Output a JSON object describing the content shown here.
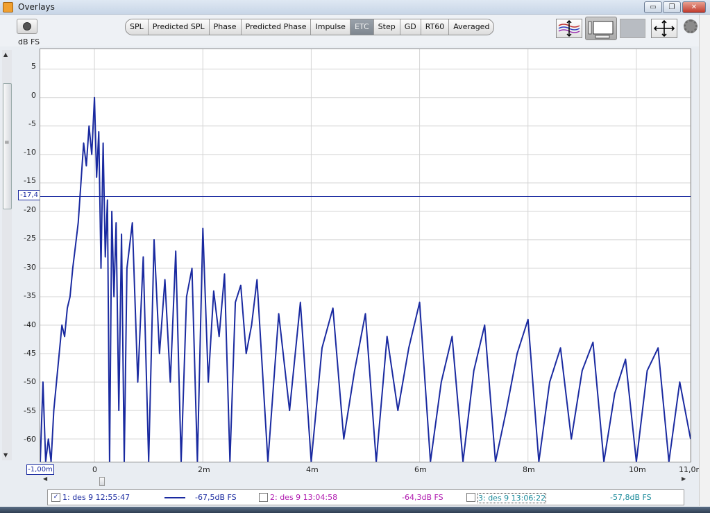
{
  "window": {
    "title": "Overlays",
    "minimize": "▭",
    "maximize": "❐",
    "close": "✕"
  },
  "toolbar": {
    "unit_label": "dB FS",
    "tabs": [
      {
        "label": "SPL",
        "active": false
      },
      {
        "label": "Predicted SPL",
        "active": false
      },
      {
        "label": "Phase",
        "active": false
      },
      {
        "label": "Predicted Phase",
        "active": false
      },
      {
        "label": "Impulse",
        "active": false
      },
      {
        "label": "ETC",
        "active": true
      },
      {
        "label": "Step",
        "active": false
      },
      {
        "label": "GD",
        "active": false
      },
      {
        "label": "RT60",
        "active": false
      },
      {
        "label": "Averaged",
        "active": false
      }
    ],
    "tools": [
      "y-scale-icon",
      "graph-view-icon",
      "blank-tool-icon",
      "expand-icon",
      "gear-icon"
    ]
  },
  "plot": {
    "cursor_label": "-17,4",
    "x_start_label": "-1,00m"
  },
  "chart_data": {
    "type": "line",
    "title": "",
    "ylabel": "dB FS",
    "xlabel": "",
    "ylim": [
      -64,
      8.5
    ],
    "xlim": [
      -1.0,
      11.0
    ],
    "y_ticks": [
      "5",
      "0",
      "-5",
      "-10",
      "-15",
      "-20",
      "-25",
      "-30",
      "-35",
      "-40",
      "-45",
      "-50",
      "-55",
      "-60"
    ],
    "x_ticks": [
      "0",
      "2m",
      "4m",
      "6m",
      "8m",
      "10m",
      "11,0ms"
    ],
    "x_tick_values": [
      0,
      2,
      4,
      6,
      8,
      10,
      11
    ],
    "cursor_y": -17.4,
    "grid": true,
    "series": [
      {
        "name": "1: des 9 12:55:47",
        "color": "#1a2aa0",
        "x": [
          -1.0,
          -0.95,
          -0.9,
          -0.85,
          -0.8,
          -0.75,
          -0.7,
          -0.65,
          -0.6,
          -0.55,
          -0.5,
          -0.45,
          -0.4,
          -0.35,
          -0.3,
          -0.25,
          -0.2,
          -0.15,
          -0.1,
          -0.05,
          0.0,
          0.04,
          0.08,
          0.12,
          0.16,
          0.2,
          0.24,
          0.28,
          0.32,
          0.36,
          0.4,
          0.45,
          0.5,
          0.55,
          0.6,
          0.7,
          0.8,
          0.9,
          1.0,
          1.1,
          1.2,
          1.3,
          1.4,
          1.5,
          1.6,
          1.7,
          1.8,
          1.9,
          2.0,
          2.1,
          2.2,
          2.3,
          2.4,
          2.5,
          2.6,
          2.7,
          2.8,
          2.9,
          3.0,
          3.2,
          3.4,
          3.6,
          3.8,
          4.0,
          4.2,
          4.4,
          4.6,
          4.8,
          5.0,
          5.2,
          5.4,
          5.6,
          5.8,
          6.0,
          6.2,
          6.4,
          6.6,
          6.8,
          7.0,
          7.2,
          7.4,
          7.6,
          7.8,
          8.0,
          8.2,
          8.4,
          8.6,
          8.8,
          9.0,
          9.2,
          9.4,
          9.6,
          9.8,
          10.0,
          10.2,
          10.4,
          10.6,
          10.8,
          11.0
        ],
        "y": [
          -64,
          -50,
          -64,
          -60,
          -64,
          -55,
          -50,
          -45,
          -40,
          -42,
          -37,
          -35,
          -30,
          -26,
          -22,
          -15,
          -8,
          -12,
          -5,
          -10,
          0,
          -14,
          -6,
          -30,
          -8,
          -28,
          -18,
          -64,
          -20,
          -35,
          -22,
          -55,
          -24,
          -64,
          -30,
          -22,
          -50,
          -28,
          -64,
          -25,
          -45,
          -32,
          -50,
          -27,
          -64,
          -35,
          -30,
          -64,
          -23,
          -50,
          -34,
          -42,
          -31,
          -64,
          -36,
          -33,
          -45,
          -40,
          -32,
          -64,
          -38,
          -55,
          -36,
          -64,
          -44,
          -37,
          -60,
          -48,
          -38,
          -64,
          -42,
          -55,
          -44,
          -36,
          -64,
          -50,
          -42,
          -64,
          -48,
          -40,
          -64,
          -55,
          -45,
          -39,
          -64,
          -50,
          -44,
          -60,
          -48,
          -43,
          -64,
          -52,
          -46,
          -64,
          -48,
          -44,
          -64,
          -50,
          -60
        ]
      }
    ]
  },
  "legend": [
    {
      "checked": true,
      "label": "1: des 9 12:55:47",
      "value": "-67,5dB FS",
      "color": "#1a2aa0"
    },
    {
      "checked": false,
      "label": "2: des 9 13:04:58",
      "value": "-64,3dB FS",
      "color": "#b01ab0"
    },
    {
      "checked": false,
      "label": "3: des 9 13:06:22",
      "value": "-57,8dB FS",
      "color": "#1a8a9a"
    }
  ]
}
